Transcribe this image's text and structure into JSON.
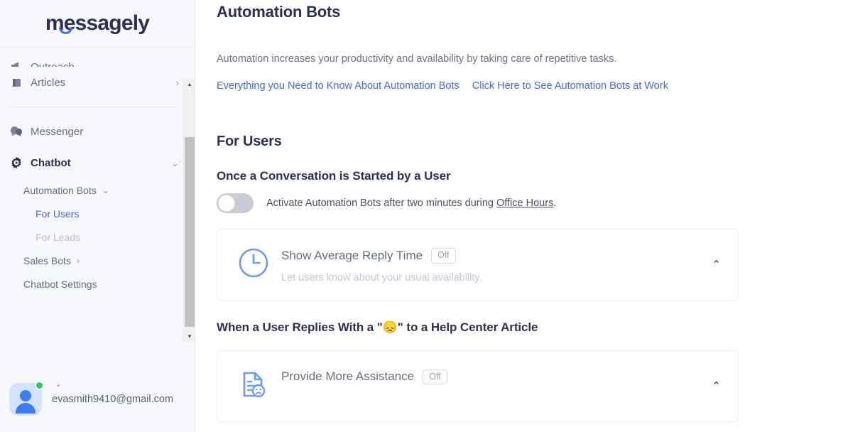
{
  "brand": {
    "name": "messagely"
  },
  "sidebar": {
    "items": [
      {
        "label": "Outreach",
        "icon": "megaphone-icon",
        "caret": "›",
        "state": "clipped"
      },
      {
        "label": "Articles",
        "icon": "book-icon",
        "caret": "›",
        "state": "normal"
      },
      {
        "label": "Messenger",
        "icon": "chat-bubbles-icon",
        "caret": "",
        "state": "normal"
      },
      {
        "label": "Chatbot",
        "icon": "gear-icon",
        "caret": "⌄",
        "state": "active-dark"
      }
    ],
    "sub_items": [
      {
        "label": "Automation Bots",
        "caret": "⌄",
        "level": 1,
        "state": "normal"
      },
      {
        "label": "For Users",
        "caret": "",
        "level": 2,
        "state": "selected"
      },
      {
        "label": "For Leads",
        "caret": "",
        "level": 2,
        "state": "muted"
      },
      {
        "label": "Sales Bots",
        "caret": "›",
        "level": 1,
        "state": "normal"
      },
      {
        "label": "Chatbot Settings",
        "caret": "",
        "level": 1,
        "state": "normal"
      }
    ],
    "scrollbar": {
      "up_arrow": "▲",
      "down_arrow": "▼"
    },
    "user": {
      "email": "evasmith9410@gmail.com",
      "caret": "⌄",
      "status": "online"
    }
  },
  "main": {
    "page_title": "Automation Bots",
    "intro": "Automation increases your productivity and availability by taking care of repetitive tasks.",
    "links": [
      {
        "label": "Everything you Need to Know About Automation Bots"
      },
      {
        "label": "Click Here to See Automation Bots at Work"
      }
    ],
    "section_title": "For Users",
    "subsection_title": "Once a Conversation is Started by a User",
    "toggle": {
      "state": "off",
      "text_before": "Activate Automation Bots after two minutes during ",
      "link_text": "Office Hours",
      "text_after": "."
    },
    "cards": [
      {
        "icon": "clock-icon",
        "title": "Show Average Reply Time",
        "badge": "Off",
        "subtitle": "Let users know about your usual availability.",
        "chevron": "⌃"
      },
      {
        "icon": "document-sad-face-icon",
        "title": "Provide More Assistance",
        "badge": "Off",
        "subtitle": "",
        "chevron": "⌃"
      }
    ],
    "emoji_heading": {
      "before": "When a User Replies With a \"",
      "emoji": "😞",
      "after": "\" to a Help Center Article"
    }
  },
  "colors": {
    "accent_blue": "#4169e8",
    "icon_blue": "#6b9bf5",
    "dark_navy": "#2b3055",
    "muted_gray": "#9aa0b0",
    "online_green": "#35c759"
  }
}
